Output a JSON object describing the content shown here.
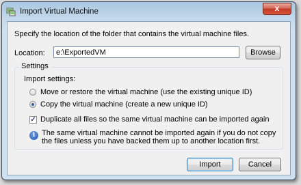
{
  "window": {
    "title": "Import Virtual Machine",
    "close_symbol": "x"
  },
  "instruction": "Specify the location of the folder that contains the virtual machine files.",
  "location": {
    "label": "Location:",
    "value": "e:\\ExportedVM",
    "browse_label": "Browse"
  },
  "settings": {
    "group_label": "Settings",
    "import_settings_label": "Import settings:",
    "options": [
      {
        "label": "Move or restore the virtual machine (use the existing unique ID)",
        "selected": false
      },
      {
        "label": "Copy the virtual machine (create a new unique ID)",
        "selected": true
      }
    ],
    "duplicate_label": "Duplicate all files so the same virtual machine can be imported again",
    "duplicate_checked": true,
    "info_text": "The same virtual machine cannot be imported again if you do not copy the files unless you have backed them up to another location first."
  },
  "buttons": {
    "import": "Import",
    "cancel": "Cancel"
  },
  "icons": {
    "app": "virtual-machine-icon",
    "close": "close-icon",
    "info": "info-icon",
    "check": "checkmark-icon"
  }
}
